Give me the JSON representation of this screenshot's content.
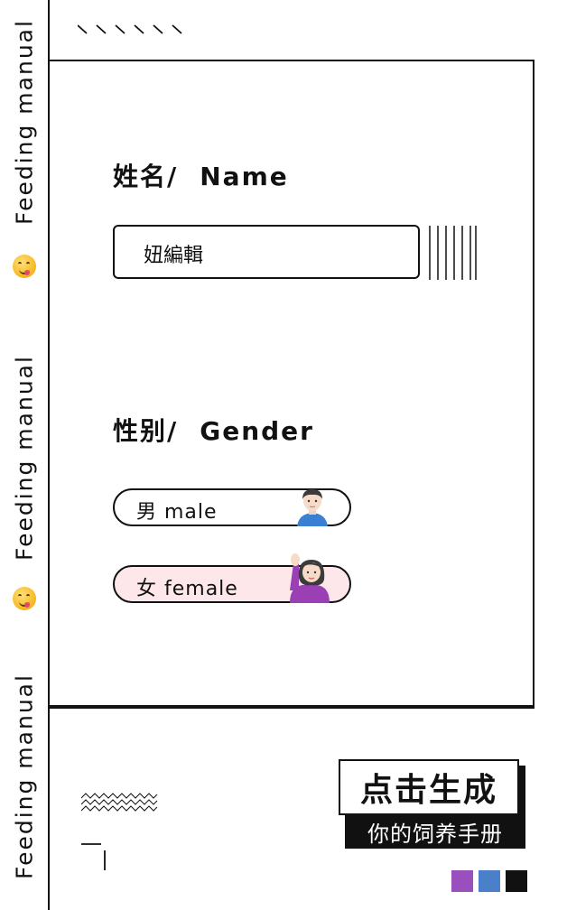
{
  "sidebar": {
    "repeat_text": "Feeding manual"
  },
  "name_section": {
    "title_cn": "姓名/",
    "title_en": "Name",
    "value": "妞編輯"
  },
  "gender_section": {
    "title_cn": "性别/",
    "title_en": "Gender",
    "options": [
      {
        "label": "男 male",
        "avatar": "man-emoji",
        "background": "#ffffff"
      },
      {
        "label": "女 female",
        "avatar": "woman-raising-hand-emoji",
        "background": "#fde7ea"
      }
    ]
  },
  "cta": {
    "label": "点击生成",
    "subtitle": "你的饲养手册"
  },
  "color_squares": [
    "#9b4fbe",
    "#4a7fc9",
    "#111111"
  ]
}
